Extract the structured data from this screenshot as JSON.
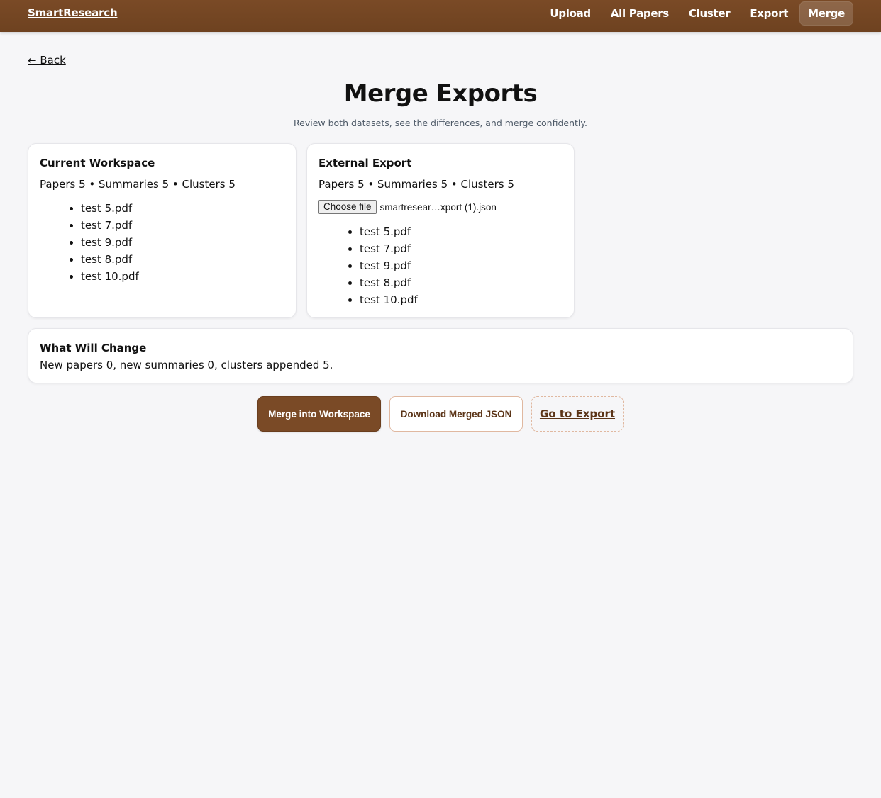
{
  "nav": {
    "brand": "SmartResearch",
    "links": [
      {
        "label": "Upload"
      },
      {
        "label": "All Papers"
      },
      {
        "label": "Cluster"
      },
      {
        "label": "Export"
      },
      {
        "label": "Merge",
        "active": true
      }
    ]
  },
  "back_label": "← Back",
  "page": {
    "title": "Merge Exports",
    "subtitle": "Review both datasets, see the differences, and merge confidently."
  },
  "current": {
    "title": "Current Workspace",
    "stats": "Papers 5 • Summaries 5 • Clusters 5",
    "files": [
      "test 5.pdf",
      "test 7.pdf",
      "test 9.pdf",
      "test 8.pdf",
      "test 10.pdf"
    ]
  },
  "external": {
    "title": "External Export",
    "stats": "Papers 5 • Summaries 5 • Clusters 5",
    "choose_file_label": "Choose file",
    "file_name": "smartresear…xport (1).json",
    "files": [
      "test 5.pdf",
      "test 7.pdf",
      "test 9.pdf",
      "test 8.pdf",
      "test 10.pdf"
    ]
  },
  "changes": {
    "title": "What Will Change",
    "summary": "New papers 0, new summaries 0, clusters appended 5."
  },
  "actions": {
    "merge_label": "Merge into Workspace",
    "download_label": "Download Merged JSON",
    "export_label": "Go to Export"
  },
  "colors": {
    "brand_brown": "#7a4a26",
    "page_bg": "#f6f6f8",
    "accent_text": "#5b3417"
  }
}
